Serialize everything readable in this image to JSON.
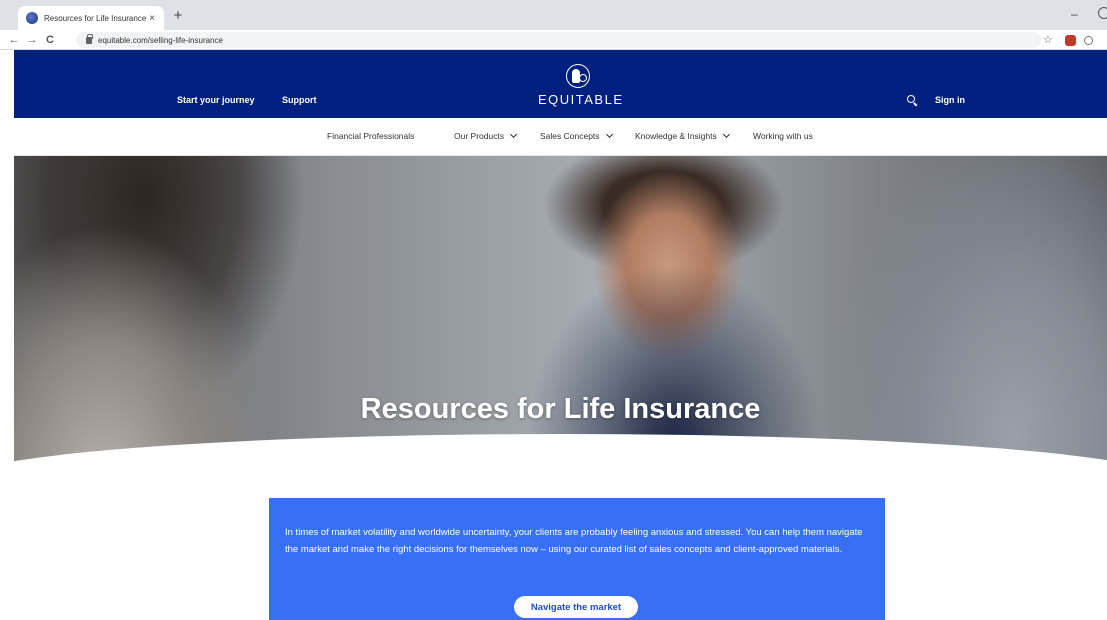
{
  "browser": {
    "tab_title": "Resources for Life Insurance",
    "tab_close": "×",
    "new_tab": "+",
    "url": "equitable.com/selling-life-insurance",
    "back": "←",
    "forward": "→",
    "reload": "C",
    "star": "☆",
    "minimize": "–"
  },
  "header": {
    "start_journey": "Start your journey",
    "support": "Support",
    "logo": "EQUITABLE",
    "sign_in": "Sign in"
  },
  "subnav": {
    "items": [
      {
        "label": "Financial Professionals",
        "dropdown": false
      },
      {
        "label": "Our Products",
        "dropdown": true
      },
      {
        "label": "Sales Concepts",
        "dropdown": true
      },
      {
        "label": "Knowledge & Insights",
        "dropdown": true
      },
      {
        "label": "Working with us",
        "dropdown": false
      }
    ]
  },
  "hero": {
    "title": "Resources for Life Insurance"
  },
  "card": {
    "text": "In times of market volatility and worldwide uncertainty, your clients are probably feeling anxious and stressed. You can help them navigate the market and make the right decisions for themselves now – using our curated list of sales concepts and client-approved materials.",
    "button": "Navigate the market"
  },
  "colors": {
    "header_bg": "#001f7e",
    "card_bg": "#3870f5",
    "button_text": "#1f4fc7"
  }
}
